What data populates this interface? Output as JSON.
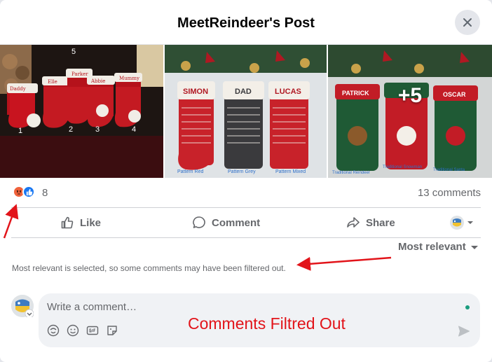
{
  "header": {
    "title": "MeetReindeer's Post"
  },
  "gallery": {
    "photos": [
      {
        "labels": [
          "Daddy",
          "Elle",
          "Parker",
          "Abbie",
          "Mummy"
        ],
        "numbers": [
          "5",
          "1",
          "2",
          "3",
          "4"
        ]
      },
      {
        "labels": [
          "SIMON",
          "DAD",
          "LUCAS"
        ],
        "captions": [
          "Pattern Red",
          "Pattern Grey",
          "Pattern Mixed"
        ]
      },
      {
        "labels": [
          "PATRICK",
          "OSCAR"
        ],
        "captions": [
          "Traditional Reindeer",
          "Traditional Snowman",
          "Traditional Santa"
        ],
        "more": "+5"
      }
    ]
  },
  "reactions": {
    "count": "8",
    "comments": "13 comments"
  },
  "actions": {
    "like": "Like",
    "comment": "Comment",
    "share": "Share"
  },
  "sort": {
    "label": "Most relevant"
  },
  "notice": "Most relevant is selected, so some comments may have been filtered out.",
  "composer": {
    "placeholder": "Write a comment…"
  },
  "annotation": {
    "text": "Comments Filtred Out",
    "color": "#e2141a"
  },
  "colors": {
    "like_blue": "#1877f2",
    "angry_orange": "#f0623b",
    "muted_gray": "#65676b"
  }
}
